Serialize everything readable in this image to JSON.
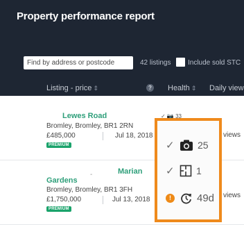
{
  "header": {
    "title": "Property performance report",
    "search_placeholder": "Find by address or postcode",
    "listings_count": "42 listings",
    "include_sold_label": "Include sold STC"
  },
  "columns": {
    "listing_price": "Listing - price",
    "listing_sort": "⇕",
    "help": "?",
    "health": "Health",
    "health_sort": "⇕",
    "daily_views": "Daily views"
  },
  "rows": [
    {
      "title": "Lewes Road",
      "address": "Bromley, Bromley, BR1 2RN",
      "price": "£485,000",
      "date": "Jul 18, 2018",
      "badge": "PREMIUM",
      "health_snippet": "✓ 📷 33",
      "views": "views"
    },
    {
      "title_right": "Marian",
      "title": "Gardens",
      "dash": "-",
      "address": "Bromley, Bromley, BR1 3FH",
      "price": "£1,750,000",
      "date": "Jul 13, 2018",
      "badge": "PREMIUM",
      "views": "views"
    }
  ],
  "health_popover": {
    "photos": {
      "icon": "camera-icon",
      "value": "25"
    },
    "floorplans": {
      "icon": "floorplan-icon",
      "value": "1"
    },
    "updated": {
      "icon": "refresh-icon",
      "value": "49d",
      "status": "warning"
    }
  },
  "colors": {
    "header_bg": "#1e2633",
    "accent_green": "#2e9f7a",
    "badge_green": "#1aa36b",
    "highlight_orange": "#ef8a1c"
  }
}
